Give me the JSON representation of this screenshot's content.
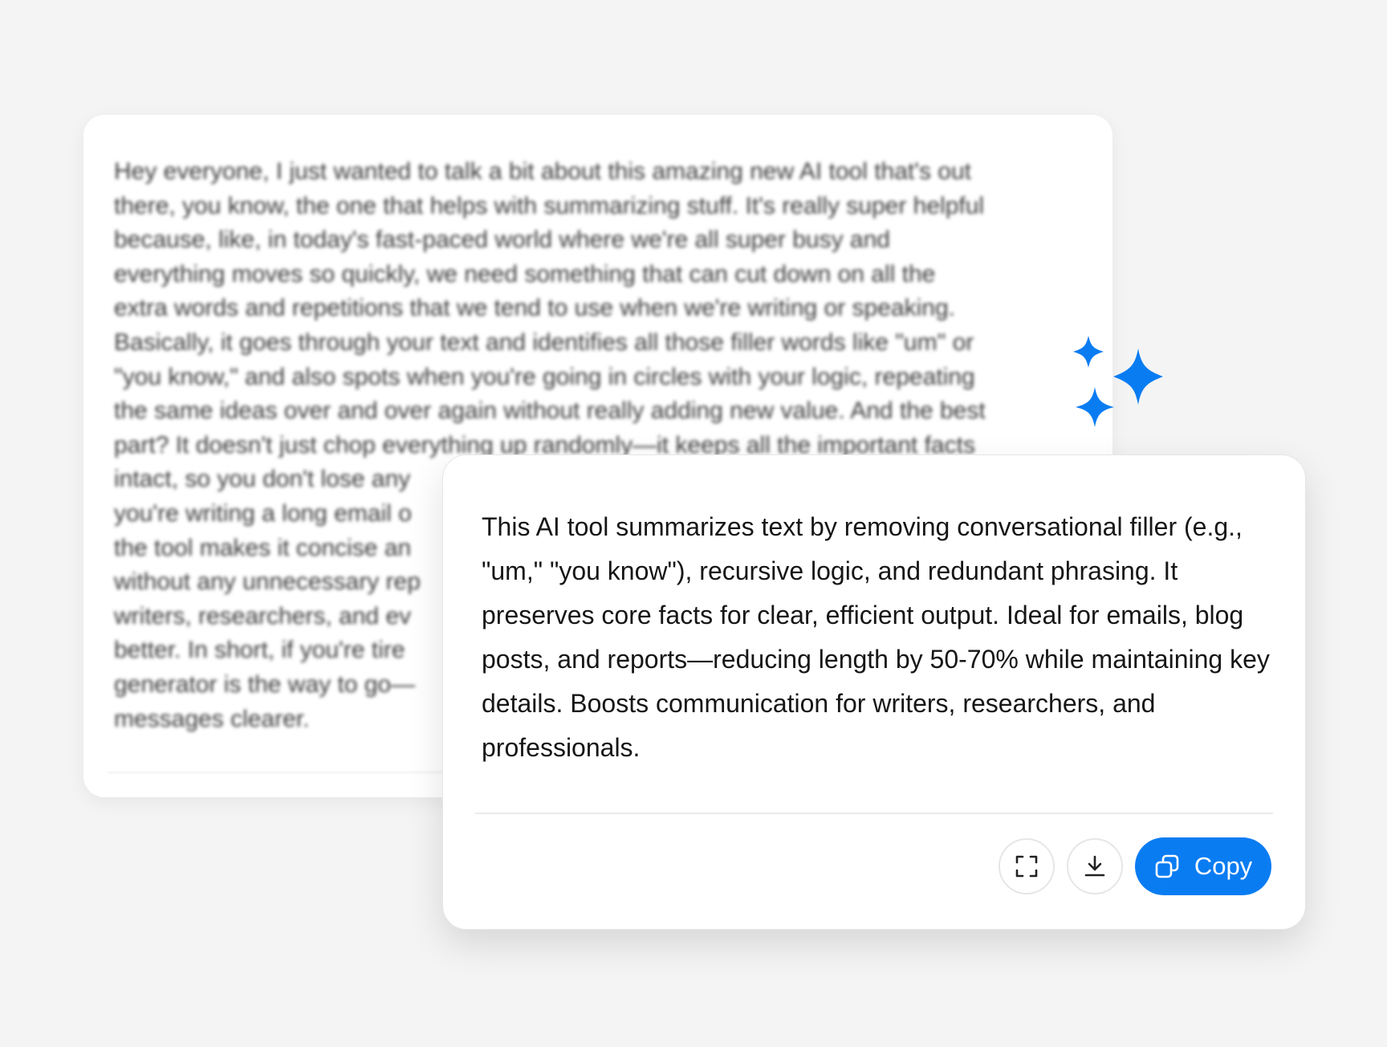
{
  "source_card": {
    "text": "Hey everyone, I just wanted to talk a bit about this amazing new AI tool that's out\nthere, you know, the one that helps with summarizing stuff. It's really super helpful\nbecause, like, in today's fast-paced world where we're all super busy and\neverything moves so quickly, we need something that can cut down on all the\nextra words and repetitions that we tend to use when we're writing or speaking.\nBasically, it goes through your text and identifies all those filler words like \"um\" or\n\"you know,\" and also spots when you're going in circles with your logic, repeating\nthe same ideas over and over again without really adding new value. And the best\npart? It doesn't just chop everything up randomly—it keeps all the important facts\nintact, so you don't lose any\nyou're writing a long email o\nthe tool makes it concise an\nwithout any unnecessary rep\nwriters, researchers, and ev\nbetter. In short, if you're tire\ngenerator is the way to go—\nmessages clearer."
  },
  "summary_card": {
    "text": "This AI tool summarizes text by removing conversational filler (e.g., \"um,\" \"you know\"), recursive logic, and redundant phrasing. It preserves core facts for clear, efficient output. Ideal for emails, blog posts, and reports—reducing length by 50-70% while maintaining key details. Boosts communication for writers, researchers, and professionals."
  },
  "actions": {
    "copy_label": "Copy",
    "fullscreen_icon": "expand-icon",
    "download_icon": "download-icon",
    "copy_icon": "copy-icon"
  },
  "decor": {
    "sparkle_icon": "sparkles-icon"
  },
  "colors": {
    "accent": "#0a7cf2",
    "background": "#f4f4f4",
    "card": "#ffffff",
    "text": "#161616"
  }
}
